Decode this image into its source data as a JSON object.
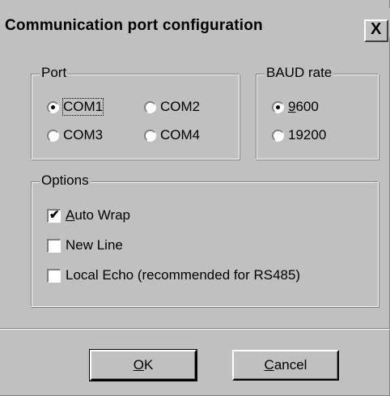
{
  "window": {
    "title": "Communication port configuration",
    "close_symbol": "X"
  },
  "port_group": {
    "legend": "Port",
    "options": [
      {
        "label": "COM1",
        "checked": true
      },
      {
        "label": "COM2",
        "checked": false
      },
      {
        "label": "COM3",
        "checked": false
      },
      {
        "label": "COM4",
        "checked": false
      }
    ]
  },
  "baud_group": {
    "legend": "BAUD rate",
    "options": [
      {
        "label_mnemonic": "9",
        "label_rest": "600",
        "checked": true
      },
      {
        "label": "19200",
        "checked": false
      }
    ]
  },
  "options_group": {
    "legend": "Options",
    "items": [
      {
        "label_mnemonic": "A",
        "label_rest": "uto Wrap",
        "checked": true
      },
      {
        "label": "New Line",
        "checked": false
      },
      {
        "label": "Local Echo (recommended for RS485)",
        "checked": false
      }
    ]
  },
  "buttons": {
    "ok_mnemonic": "O",
    "ok_rest": "K",
    "cancel_mnemonic": "C",
    "cancel_rest": "ancel"
  }
}
